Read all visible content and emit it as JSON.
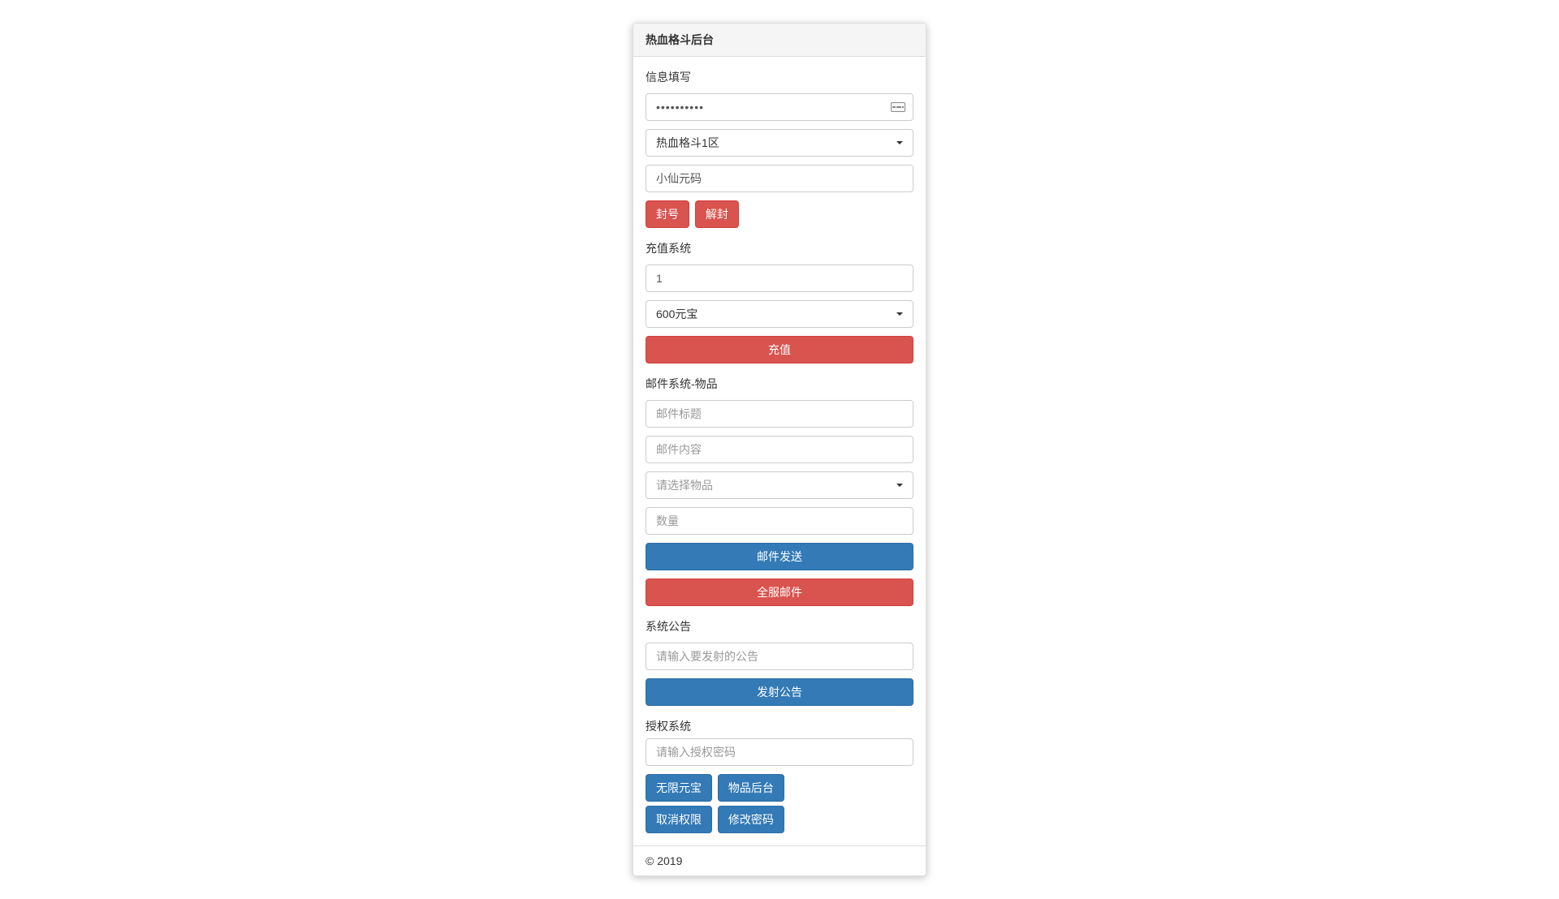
{
  "panel": {
    "title": "热血格斗后台"
  },
  "info": {
    "label": "信息填写",
    "password_value": "••••••••••",
    "server_selected": "热血格斗1区",
    "player_value": "小仙元码",
    "ban_label": "封号",
    "unban_label": "解封"
  },
  "recharge": {
    "label": "充值系统",
    "amount_value": "1",
    "package_selected": "600元宝",
    "button_label": "充值"
  },
  "mail": {
    "label": "邮件系统-物品",
    "title_placeholder": "邮件标题",
    "content_placeholder": "邮件内容",
    "item_placeholder": "请选择物品",
    "qty_placeholder": "数量",
    "send_label": "邮件发送",
    "all_server_label": "全服邮件"
  },
  "announce": {
    "label": "系统公告",
    "placeholder": "请输入要发射的公告",
    "button_label": "发射公告"
  },
  "auth": {
    "label": "授权系统",
    "placeholder": "请输入授权密码",
    "unlimited_gold": "无限元宝",
    "item_backend": "物品后台",
    "cancel_perm": "取消权限",
    "change_pwd": "修改密码"
  },
  "footer": {
    "copyright": "© 2019"
  }
}
